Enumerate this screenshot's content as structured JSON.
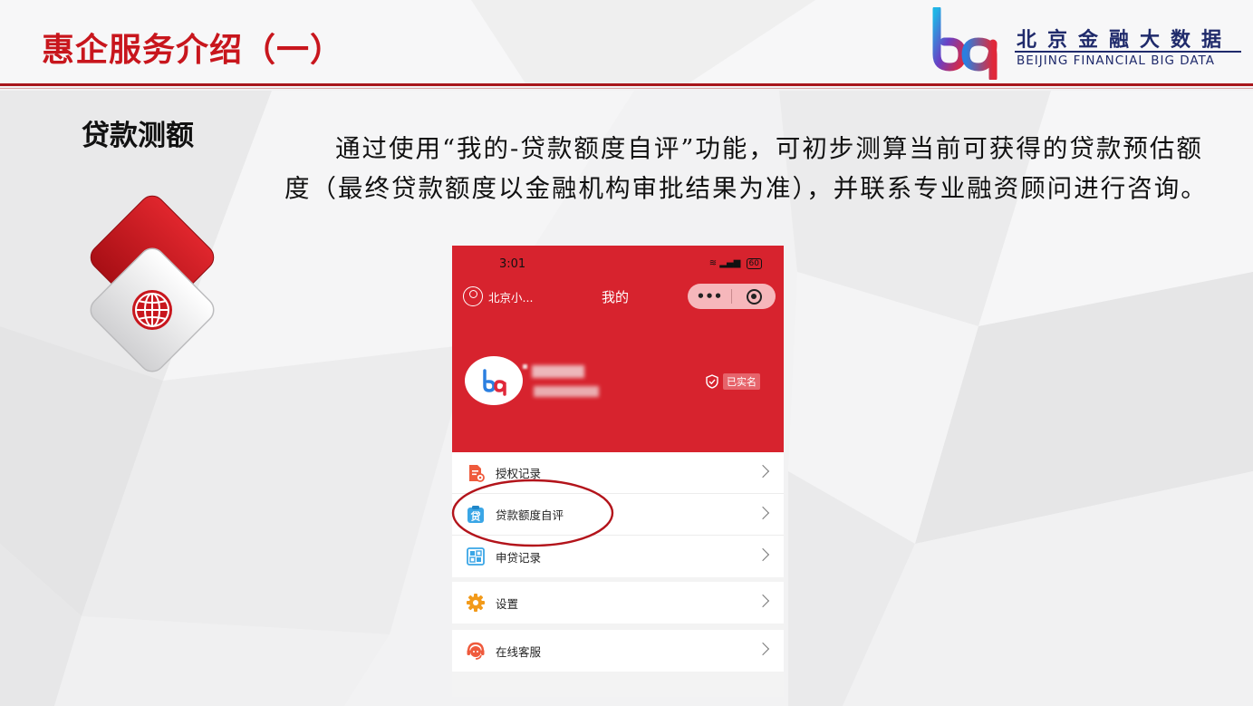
{
  "slide": {
    "title": "惠企服务介绍（一）",
    "section_label": "贷款测额",
    "description": "通过使用“我的-贷款额度自评”功能，可初步测算当前可获得的贷款预估额度（最终贷款额度以金融机构审批结果为准），并联系专业融资顾问进行咨询。"
  },
  "logo": {
    "name_cn": "北京金融大数据",
    "name_en": "BEIJING FINANCIAL BIG DATA"
  },
  "section_icon": "globe-icon",
  "phone": {
    "status_bar": {
      "time": "3:01",
      "battery": "60"
    },
    "nav": {
      "user_label": "北京小...",
      "title": "我的",
      "more_label": "•••"
    },
    "profile": {
      "verified_label": "已实名"
    },
    "menu_groups": [
      {
        "items": [
          {
            "label": "授权记录",
            "icon": "document-key-icon"
          },
          {
            "label": "贷款额度自评",
            "icon": "loan-icon",
            "icon_text": "贷"
          },
          {
            "label": "申贷记录",
            "icon": "record-grid-icon"
          }
        ]
      },
      {
        "items": [
          {
            "label": "设置",
            "icon": "gear-icon"
          }
        ]
      },
      {
        "items": [
          {
            "label": "在线客服",
            "icon": "customer-service-icon"
          }
        ]
      }
    ]
  },
  "colors": {
    "brand_red": "#c8161d",
    "phone_header_red": "#d7232e",
    "logo_navy": "#1f2a6b",
    "annotation_ring": "#b3141b"
  }
}
